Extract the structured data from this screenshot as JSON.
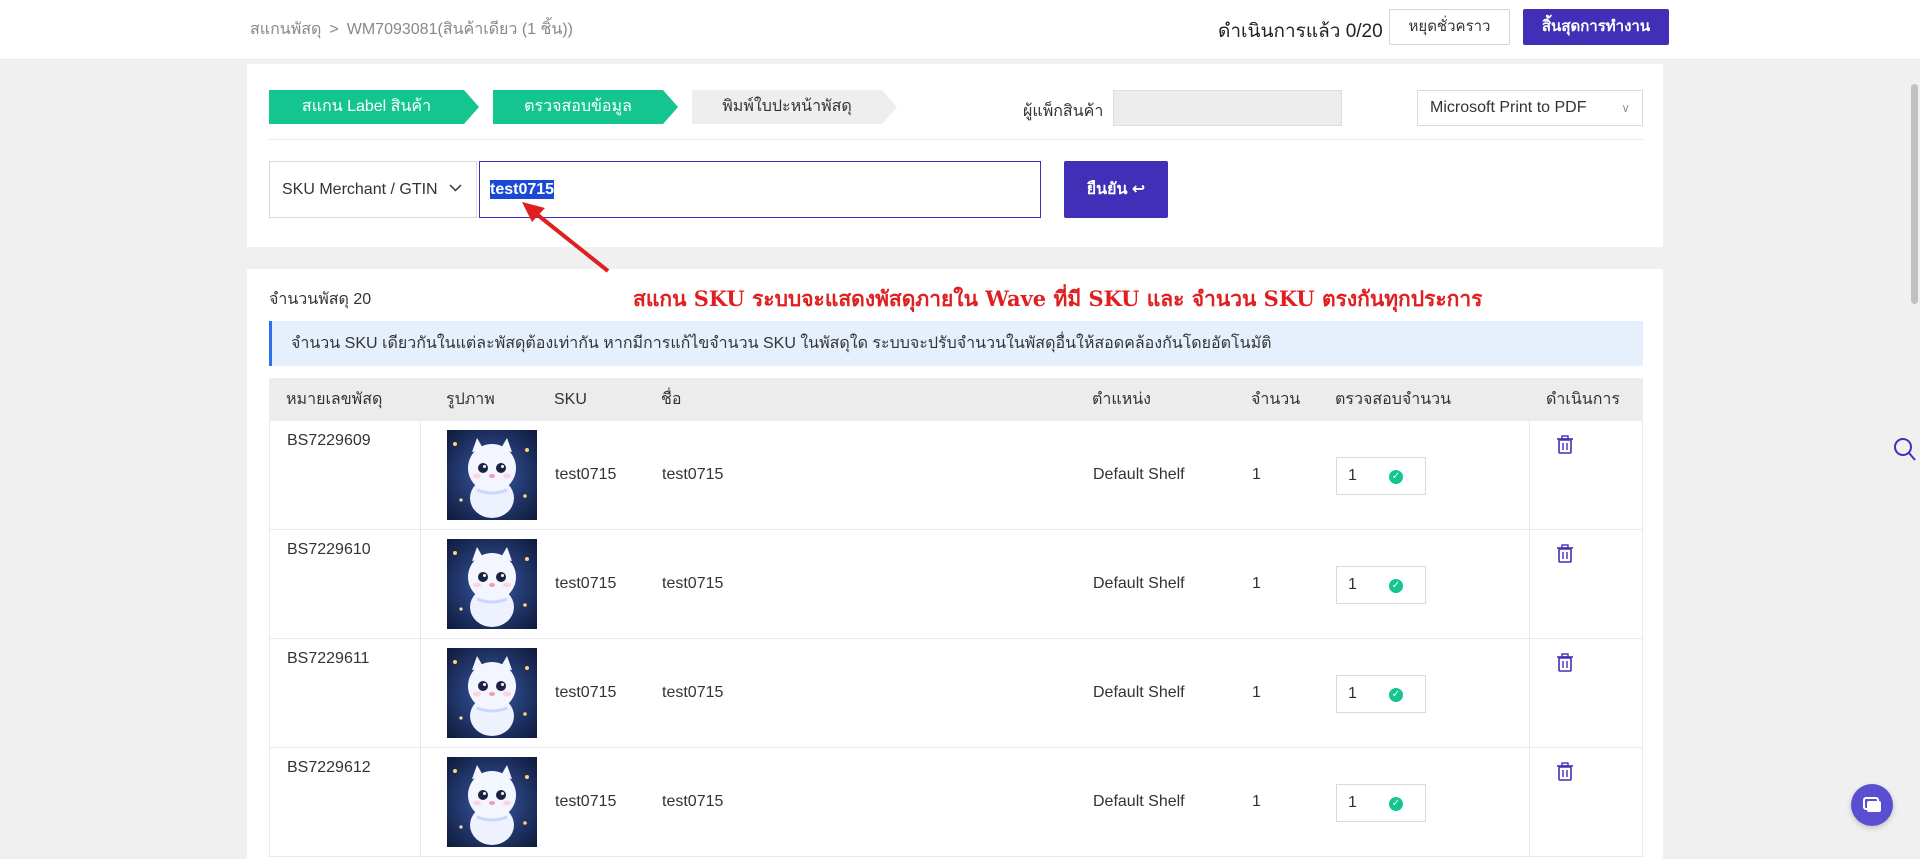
{
  "header": {
    "breadcrumb": [
      "สแกนพัสดุ",
      "WM7093081(สินค้าเดียว (1 ชิ้น))"
    ],
    "breadcrumb_sep": ">",
    "progress": "ดำเนินการแล้ว 0/20",
    "pause_label": "หยุดชั่วคราว",
    "finish_label": "สิ้นสุดการทำงาน"
  },
  "steps": [
    "สแกน Label สินค้า",
    "ตรวจสอบข้อมูล",
    "พิมพ์ใบปะหน้าพัสดุ"
  ],
  "packer": {
    "label": "ผู้แพ็กสินค้า",
    "value": ""
  },
  "printer": {
    "selected": "Microsoft Print to PDF"
  },
  "scan": {
    "type_selected": "SKU Merchant / GTIN",
    "value": "test0715",
    "confirm_label": "ยืนยัน ↩"
  },
  "annotation": "สแกน SKU ระบบจะแสดงพัสดุภายใน Wave  ที่มี SKU และ จำนวน SKU ตรงกันทุกประการ",
  "list": {
    "count_label": "จำนวนพัสดุ 20",
    "info": "จำนวน SKU เดียวกันในแต่ละพัสดุต้องเท่ากัน หากมีการแก้ไขจำนวน SKU ในพัสดุใด ระบบจะปรับจำนวนในพัสดุอื่นให้สอดคล้องกันโดยอัตโนมัติ",
    "columns": {
      "parcel": "หมายเลขพัสดุ",
      "image": "รูปภาพ",
      "sku": "SKU",
      "name": "ชื่อ",
      "location": "ตำแหน่ง",
      "qty": "จำนวน",
      "check": "ตรวจสอบจำนวน",
      "action": "ดำเนินการ"
    },
    "rows": [
      {
        "parcel": "BS7229609",
        "sku": "test0715",
        "name": "test0715",
        "location": "Default Shelf",
        "qty": "1",
        "check": "1"
      },
      {
        "parcel": "BS7229610",
        "sku": "test0715",
        "name": "test0715",
        "location": "Default Shelf",
        "qty": "1",
        "check": "1"
      },
      {
        "parcel": "BS7229611",
        "sku": "test0715",
        "name": "test0715",
        "location": "Default Shelf",
        "qty": "1",
        "check": "1"
      },
      {
        "parcel": "BS7229612",
        "sku": "test0715",
        "name": "test0715",
        "location": "Default Shelf",
        "qty": "1",
        "check": "1"
      }
    ]
  },
  "colors": {
    "accent": "#4130b7",
    "success": "#14c58f",
    "annotation": "#e02020",
    "info_bg": "#e6f0fd"
  },
  "icons": {
    "search": "search-icon",
    "chat": "chat-icon",
    "delete": "trash-icon",
    "check": "check-circle-icon"
  }
}
